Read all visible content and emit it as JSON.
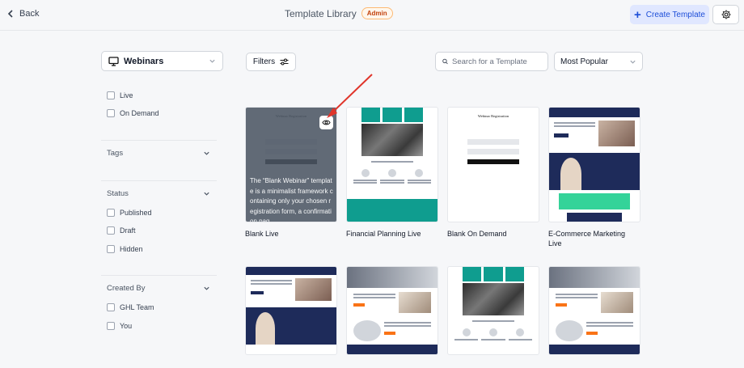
{
  "header": {
    "back_label": "Back",
    "title": "Template Library",
    "badge": "Admin",
    "create_label": "Create Template"
  },
  "sidebar": {
    "category": "Webinars",
    "type_options": [
      "Live",
      "On Demand"
    ],
    "tags_label": "Tags",
    "status_label": "Status",
    "status_options": [
      "Published",
      "Draft",
      "Hidden"
    ],
    "created_by_label": "Created By",
    "created_by_options": [
      "GHL Team",
      "You"
    ]
  },
  "toolbar": {
    "filters_label": "Filters",
    "search_placeholder": "Search for a Template",
    "sort_label": "Most Popular"
  },
  "cards": [
    {
      "title": "Blank Live",
      "thumb_heading": "Webinar Registration",
      "description": "The “Blank Webinar” template is a minimalist framework containing only your chosen registration form, a confirmation pag..."
    },
    {
      "title": "Financial Planning Live"
    },
    {
      "title": "Blank On Demand",
      "thumb_heading": "Webinar Registration"
    },
    {
      "title": "E-Commerce Marketing Live"
    }
  ],
  "colors": {
    "accent": "#1d4ed8",
    "teal": "#0f9d8f",
    "navy": "#1e2b5a",
    "annotation_arrow": "#e0352b"
  }
}
